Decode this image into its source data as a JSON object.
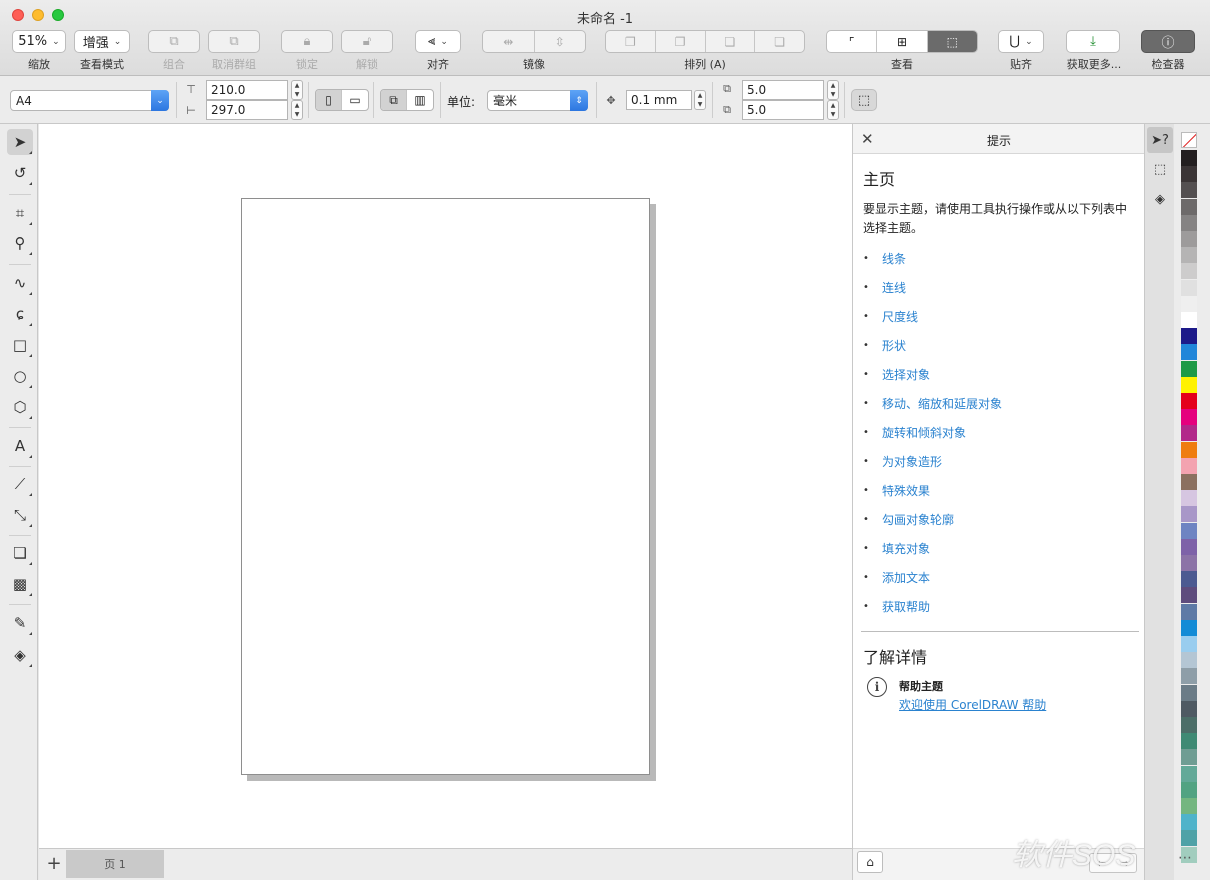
{
  "window": {
    "title": "未命名 -1"
  },
  "toolbar": {
    "zoom": {
      "value": "51%",
      "label": "缩放"
    },
    "view_mode": {
      "value": "增强",
      "label": "查看模式"
    },
    "group_label": "组合",
    "ungroup_label": "取消群组",
    "lock_label": "锁定",
    "unlock_label": "解锁",
    "align_label": "对齐",
    "mirror_label": "镜像",
    "arrange_label": "排列 (A)",
    "view_label": "查看",
    "snap_label": "贴齐",
    "get_more_label": "获取更多...",
    "inspector_label": "检查器"
  },
  "propbar": {
    "page_size": "A4",
    "width": "210.0",
    "height": "297.0",
    "unit_label": "单位:",
    "unit_value": "毫米",
    "nudge": "0.1 mm",
    "dup_x": "5.0",
    "dup_y": "5.0"
  },
  "pagebar": {
    "add": "+",
    "page_tab": "页 1"
  },
  "docker": {
    "title": "提示",
    "home_heading": "主页",
    "home_desc": "要显示主题，请使用工具执行操作或从以下列表中选择主题。",
    "bullet": "•",
    "topics": [
      "线条",
      "连线",
      "尺度线",
      "形状",
      "选择对象",
      "移动、缩放和延展对象",
      "旋转和倾斜对象",
      "为对象造形",
      "特殊效果",
      "勾画对象轮廓",
      "填充对象",
      "添加文本",
      "获取帮助"
    ],
    "learn_heading": "了解详情",
    "help_topic_label": "帮助主题",
    "help_link": "欢迎使用 CorelDRAW 帮助"
  },
  "palette": {
    "colors": [
      "#231f20",
      "#3b3536",
      "#545051",
      "#6d6a6a",
      "#858383",
      "#9d9b9b",
      "#b5b4b4",
      "#cdcccc",
      "#e0e0e0",
      "#efefef",
      "#ffffff",
      "#1d1a89",
      "#2186d9",
      "#1e9a46",
      "#fff200",
      "#e4001b",
      "#e5007e",
      "#b2288a",
      "#ef7d10",
      "#f3a3b0",
      "#8b7060",
      "#d6c6e1",
      "#a897c8",
      "#6e84c2",
      "#7e62a8",
      "#8c73a7",
      "#4c5a91",
      "#5e4c7d",
      "#5e7aa6",
      "#138bd6",
      "#99cdef",
      "#b4c6d4",
      "#8e9ea8",
      "#6b7c87",
      "#4f5a63",
      "#4c6e68",
      "#3f8a74",
      "#6f9d93",
      "#63a998",
      "#52a382",
      "#74b680",
      "#4fb3ca",
      "#4fa2a7",
      "#a1cdbe"
    ]
  },
  "watermark": "软件SOS"
}
